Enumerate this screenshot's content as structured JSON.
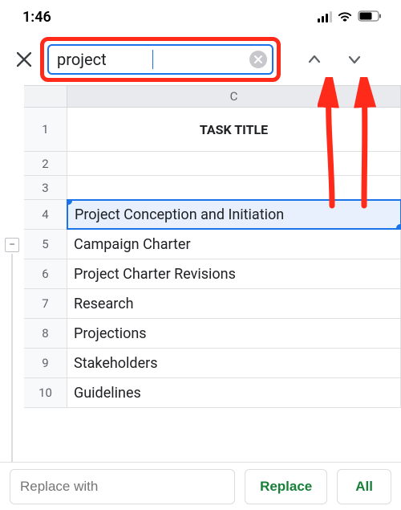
{
  "status": {
    "time": "1:46"
  },
  "search": {
    "value": "project",
    "clear_symbol": "✕"
  },
  "nav": {
    "up": "up",
    "down": "down"
  },
  "sheet": {
    "column_label": "C",
    "rows": [
      {
        "num": "1",
        "text": "TASK TITLE",
        "header": true,
        "tall": true
      },
      {
        "num": "2",
        "text": "",
        "short": true
      },
      {
        "num": "3",
        "text": "",
        "short": true
      },
      {
        "num": "4",
        "text": "Project Conception and Initiation",
        "selected": true
      },
      {
        "num": "5",
        "text": "Campaign Charter"
      },
      {
        "num": "6",
        "text": "Project Charter Revisions"
      },
      {
        "num": "7",
        "text": "Research"
      },
      {
        "num": "8",
        "text": "Projections"
      },
      {
        "num": "9",
        "text": "Stakeholders"
      },
      {
        "num": "10",
        "text": "Guidelines"
      }
    ],
    "collapse_symbol": "−"
  },
  "replace": {
    "placeholder": "Replace with",
    "replace_label": "Replace",
    "all_label": "All"
  },
  "annotation": {
    "highlight_color": "#ff2a1a"
  }
}
